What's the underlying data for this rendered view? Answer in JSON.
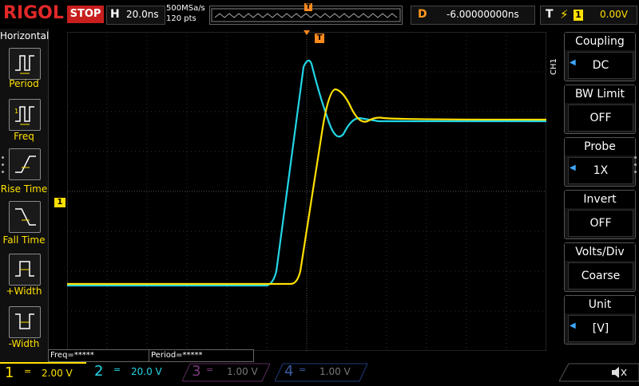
{
  "top": {
    "brand": "RIGOL",
    "run_state": "STOP",
    "timebase_letter": "H",
    "timebase": "20.0ns",
    "sample_rate": "500MSa/s",
    "points": "120 pts",
    "delay_letter": "D",
    "delay": "-6.00000000ns",
    "trigger_letter": "T",
    "trigger_edge": "⚡",
    "trigger_source": "1",
    "trigger_level": "0.00V"
  },
  "left_menu": {
    "title": "Horizontal",
    "items": [
      {
        "label": "Period"
      },
      {
        "label": "Freq"
      },
      {
        "label": "Rise Time"
      },
      {
        "label": "Fall Time"
      },
      {
        "label": "+Width"
      },
      {
        "label": "-Width"
      }
    ]
  },
  "right_menu": {
    "channel_tag": "CH1",
    "items": [
      {
        "title": "Coupling",
        "value": "DC"
      },
      {
        "title": "BW Limit",
        "value": "OFF"
      },
      {
        "title": "Probe",
        "value": "1X"
      },
      {
        "title": "Invert",
        "value": "OFF"
      },
      {
        "title": "Volts/Div",
        "value": "Coarse"
      },
      {
        "title": "Unit",
        "value": "[V]"
      }
    ]
  },
  "markers": {
    "trigger_top": "T",
    "ch1_marker": "1"
  },
  "measurements": {
    "freq": "Freq=*****",
    "period": "Period=*****"
  },
  "channels": [
    {
      "num": "1",
      "coupling": "=",
      "scale": "2.00 V",
      "color": "#ffe000"
    },
    {
      "num": "2",
      "coupling": "=",
      "scale": "20.0 V",
      "color": "#22d6e6"
    },
    {
      "num": "3",
      "coupling": "=",
      "scale": "1.00 V",
      "color": "#c040c0"
    },
    {
      "num": "4",
      "coupling": "=",
      "scale": "1.00 V",
      "color": "#3070ff"
    }
  ],
  "colors": {
    "ch1": "#ffe000",
    "ch2": "#22d6e6",
    "accent_orange": "#ff8a1e",
    "brand_red": "#e02828"
  },
  "icons": {
    "sound": "speaker-muted-icon"
  }
}
